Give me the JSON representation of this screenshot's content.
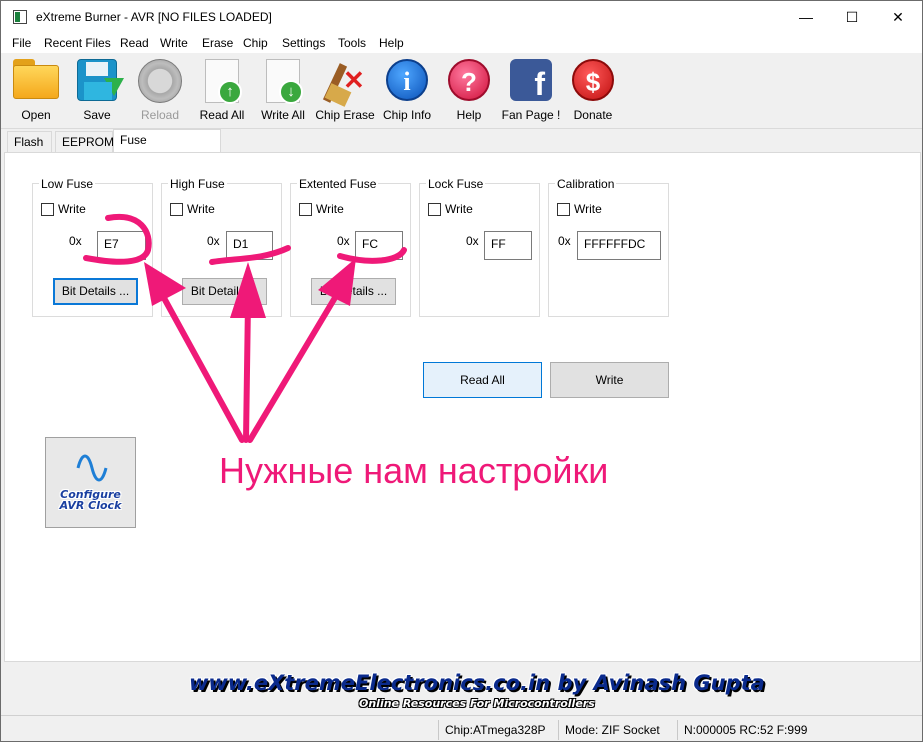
{
  "window": {
    "title": "eXtreme Burner - AVR [NO FILES LOADED]",
    "controls": {
      "minimize": "—",
      "maximize": "☐",
      "close": "✕"
    }
  },
  "menu": [
    "File",
    "Recent Files",
    "Read",
    "Write",
    "Erase",
    "Chip",
    "Settings",
    "Tools",
    "Help"
  ],
  "toolbar": {
    "open": "Open",
    "save": "Save",
    "reload": "Reload",
    "read_all": "Read All",
    "write_all": "Write All",
    "chip_erase": "Chip Erase",
    "chip_info": "Chip Info",
    "help": "Help",
    "fan_page": "Fan Page !",
    "donate": "Donate"
  },
  "tabs": [
    "Flash",
    "EEPROM",
    "Fuse Bits/Settings"
  ],
  "fuses": {
    "low": {
      "title": "Low Fuse",
      "write_label": "Write",
      "prefix": "0x",
      "value": "E7",
      "details": "Bit Details ..."
    },
    "high": {
      "title": "High Fuse",
      "write_label": "Write",
      "prefix": "0x",
      "value": "D1",
      "details": "Bit Details ..."
    },
    "extended": {
      "title": "Extented Fuse",
      "write_label": "Write",
      "prefix": "0x",
      "value": "FC",
      "details": "Bit Details ..."
    },
    "lock": {
      "title": "Lock Fuse",
      "write_label": "Write",
      "prefix": "0x",
      "value": "FF"
    },
    "calibration": {
      "title": "Calibration",
      "write_label": "Write",
      "prefix": "0x",
      "value": "FFFFFFDC"
    }
  },
  "actions": {
    "read_all": "Read All",
    "write": "Write"
  },
  "clock_button": {
    "line1": "Configure",
    "line2": "AVR Clock"
  },
  "annotation": {
    "text": "Нужные нам настройки",
    "color": "#ef1978"
  },
  "banner": {
    "main": "www.eXtremeElectronics.co.in by Avinash Gupta",
    "sub": "Online Resources For Microcontrollers"
  },
  "status": {
    "chip": "Chip:ATmega328P",
    "mode": "Mode: ZIF Socket",
    "counters": "N:000005 RC:52 F:999"
  },
  "colors": {
    "accent": "#0078d7",
    "annotation": "#ef1978",
    "banner_text": "#0a2a8c"
  },
  "icons": [
    "folder-icon",
    "floppy-save-icon",
    "reload-icon",
    "read-all-icon",
    "write-all-icon",
    "broom-erase-icon",
    "info-icon",
    "help-icon",
    "facebook-icon",
    "donate-dollar-icon",
    "sine-wave-icon"
  ]
}
